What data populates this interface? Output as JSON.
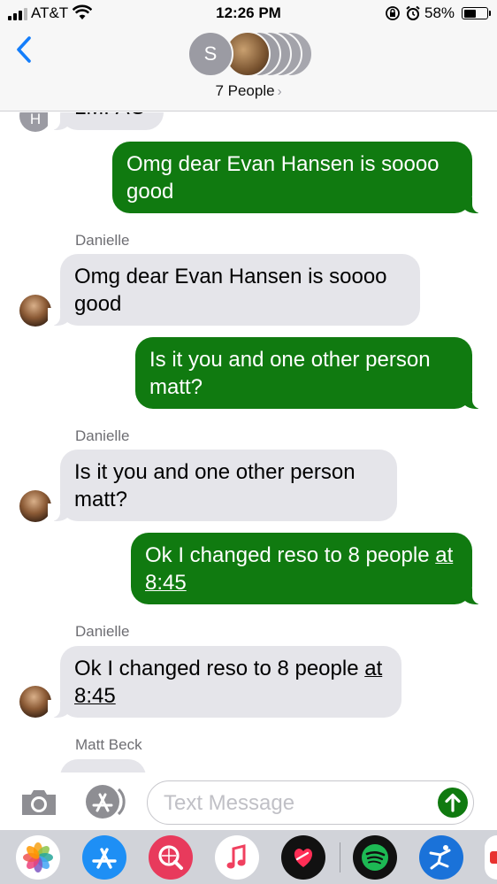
{
  "status_bar": {
    "carrier": "AT&T",
    "time": "12:26 PM",
    "battery_percent": "58%",
    "battery_level": 0.58
  },
  "header": {
    "back_icon": "chevron-left-icon",
    "group_avatar_initial": "S",
    "people_label": "7 People",
    "people_chevron": "›"
  },
  "conversation": {
    "top_partial": {
      "avatar_initial": "H",
      "text": "LMFAO"
    },
    "messages": [
      {
        "direction": "outgoing",
        "text": "Omg dear Evan Hansen is soooo good"
      },
      {
        "direction": "incoming",
        "sender": "Danielle",
        "text": "Omg dear Evan Hansen is soooo good"
      },
      {
        "direction": "outgoing",
        "text": "Is it you and one other person matt?"
      },
      {
        "direction": "incoming",
        "sender": "Danielle",
        "text": "Is it you and one other person matt?"
      },
      {
        "direction": "outgoing",
        "text_main": "Ok I changed reso to 8 people",
        "text_link": "at 8:45"
      },
      {
        "direction": "incoming",
        "sender": "Danielle",
        "text_main": "Ok I changed reso to 8 people",
        "text_link": "at 8:45"
      },
      {
        "direction": "incoming",
        "sender": "Matt Beck",
        "text": ""
      }
    ]
  },
  "compose": {
    "placeholder": "Text Message",
    "camera_icon": "camera-icon",
    "apps_icon": "app-store-icon",
    "send_icon": "send-arrow-icon"
  },
  "app_drawer": {
    "apps": [
      "photos-icon",
      "app-store-icon",
      "search-images-icon",
      "music-icon",
      "digital-touch-icon",
      "spotify-icon",
      "fitness-app-icon",
      "partial-app-icon"
    ]
  },
  "colors": {
    "outgoing_bubble": "#107a10",
    "incoming_bubble": "#e5e5ea",
    "ios_blue": "#147efb",
    "bar_background": "#f7f7f7"
  }
}
